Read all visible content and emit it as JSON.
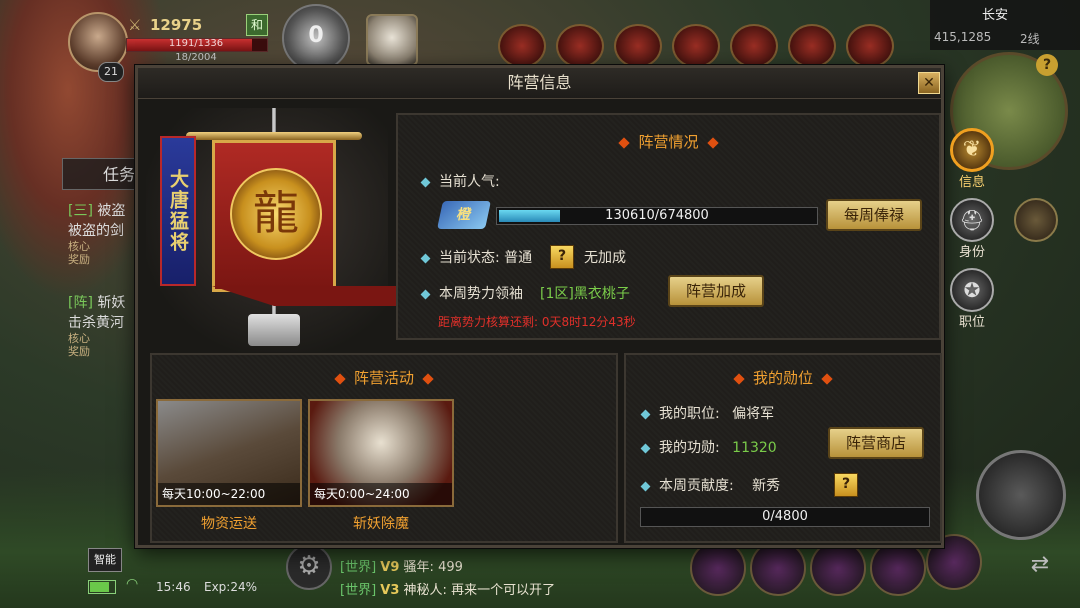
{
  "hud": {
    "power": "12975",
    "he_badge": "和",
    "hp_text": "1191/1336",
    "mp_text": "18/2004",
    "level": "21",
    "vip_level": "0",
    "power_icon": "crossed-swords-icon"
  },
  "minimap": {
    "city": "长安",
    "coords": "415,1285",
    "line": "2线",
    "help": "?"
  },
  "quests": {
    "tab_label": "任务",
    "items": [
      {
        "tag": "[三]",
        "title": "被盗",
        "desc": "被盗的剑",
        "rewards": "核心奖励"
      },
      {
        "tag": "[阵]",
        "title": "斩妖",
        "desc": "击杀黄河",
        "rewards": "核心奖励"
      }
    ]
  },
  "dialog": {
    "title": "阵营信息",
    "close": "✕",
    "motto": "大唐猛将",
    "dragon_glyph": "龍",
    "info": {
      "section_title": "阵营情况",
      "popularity_label": "当前人气:",
      "faction_badge": "橙",
      "popularity_value": 130610,
      "popularity_max": 674800,
      "popularity_text": "130610/674800",
      "weekly_salary_btn": "每周俸禄",
      "status_label": "当前状态: 普通",
      "status_help": "?",
      "status_effect": "无加成",
      "leader_label": "本周势力领袖",
      "leader_name": "[1区]黑衣桃子",
      "bonus_btn": "阵营加成",
      "countdown": "距离势力核算还剩:  0天8时12分43秒"
    },
    "activities": {
      "section_title": "阵营活动",
      "items": [
        {
          "time": "每天10:00~22:00",
          "name": "物资运送"
        },
        {
          "time": "每天0:00~24:00",
          "name": "斩妖除魔"
        }
      ]
    },
    "rank": {
      "section_title": "我的勋位",
      "position_label": "我的职位:",
      "position_value": "偏将军",
      "merit_label": "我的功勋:",
      "merit_value": "11320",
      "shop_btn": "阵营商店",
      "contribution_label": "本周贡献度:",
      "contribution_value": "新秀",
      "contribution_help": "?",
      "progress_value": 0,
      "progress_max": 4800,
      "progress_text": "0/4800"
    }
  },
  "side_tabs": [
    {
      "label": "信息",
      "icon": "ginkgo-leaf-icon",
      "active": true
    },
    {
      "label": "身份",
      "icon": "helmet-icon",
      "active": false
    },
    {
      "label": "职位",
      "icon": "emblem-icon",
      "active": false
    }
  ],
  "chat": {
    "lines": [
      {
        "channel": "[世界]",
        "vip": "V9",
        "user": "骚年:",
        "message": "499"
      },
      {
        "channel": "[世界]",
        "vip": "V3",
        "user": "神秘人:",
        "message": "再来一个可以开了"
      }
    ]
  },
  "status_bar": {
    "time": "15:46",
    "exp": "Exp:24%",
    "smart_btn": "智能",
    "battery_level": 0.8
  },
  "colors": {
    "accent_orange": "#f0a030",
    "gold_button": "#e6d08a",
    "green_text": "#7acc4a",
    "red_text": "#e0302a",
    "progress_cyan": "#4ab8e0"
  }
}
